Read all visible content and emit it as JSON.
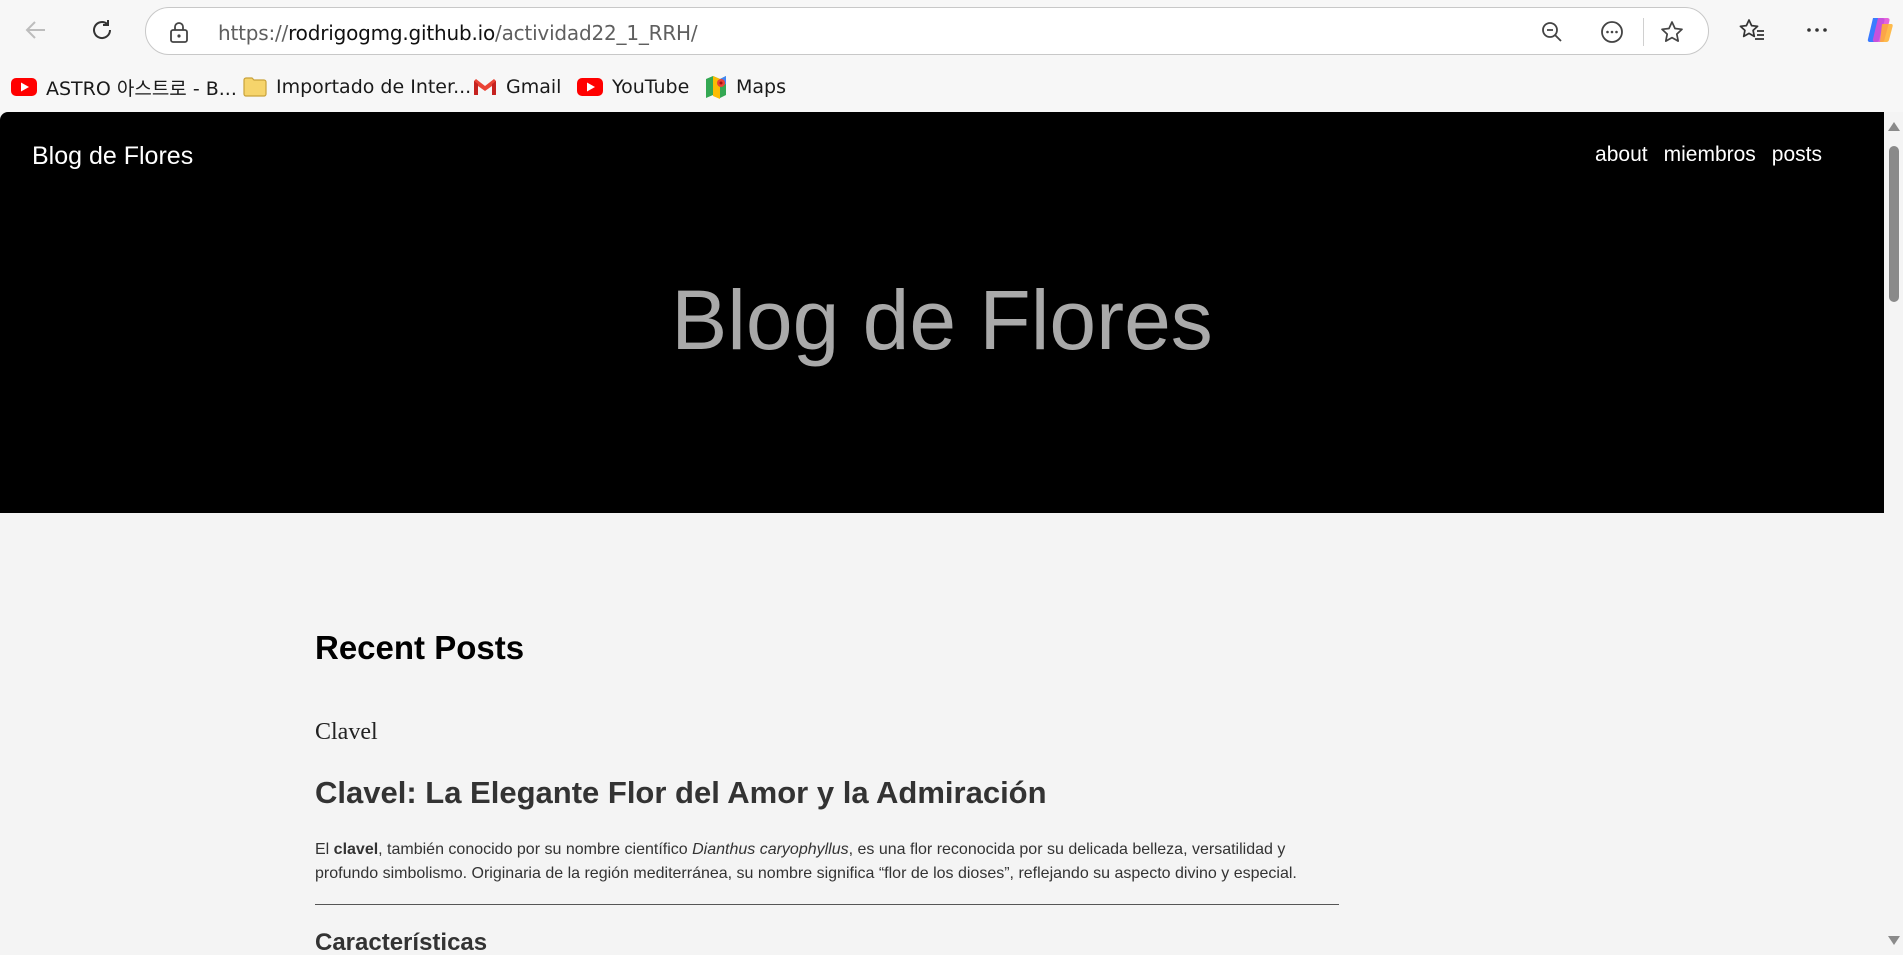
{
  "browser": {
    "url_prefix": "https://",
    "url_host": "rodrigogmg.github.io",
    "url_path": "/actividad22_1_RRH/"
  },
  "bookmarks": [
    {
      "label": "ASTRO 아스트로 - B...",
      "icon": "youtube-icon"
    },
    {
      "label": "Importado de Inter...",
      "icon": "folder-icon"
    },
    {
      "label": "Gmail",
      "icon": "gmail-icon"
    },
    {
      "label": "YouTube",
      "icon": "youtube-icon"
    },
    {
      "label": "Maps",
      "icon": "maps-icon"
    }
  ],
  "site": {
    "brand": "Blog de Flores",
    "nav": [
      "about",
      "miembros",
      "posts"
    ],
    "hero_title": "Blog de Flores"
  },
  "main": {
    "section_title": "Recent Posts",
    "post": {
      "category": "Clavel",
      "title": "Clavel: La Elegante Flor del Amor y la Admiración",
      "body_1": "El ",
      "body_bold": "clavel",
      "body_2": ", también conocido por su nombre científico ",
      "body_italic": "Dianthus caryophyllus",
      "body_3": ", es una flor reconocida por su delicada belleza, versatilidad y profundo simbolismo. Originaria de la región mediterránea, su nombre significa “flor de los dioses”, reflejando su aspecto divino y especial.",
      "subheading": "Características"
    }
  },
  "colors": {
    "hero_bg": "#000000",
    "hero_title": "#a9a9a9",
    "page_bg": "#f4f4f4"
  }
}
